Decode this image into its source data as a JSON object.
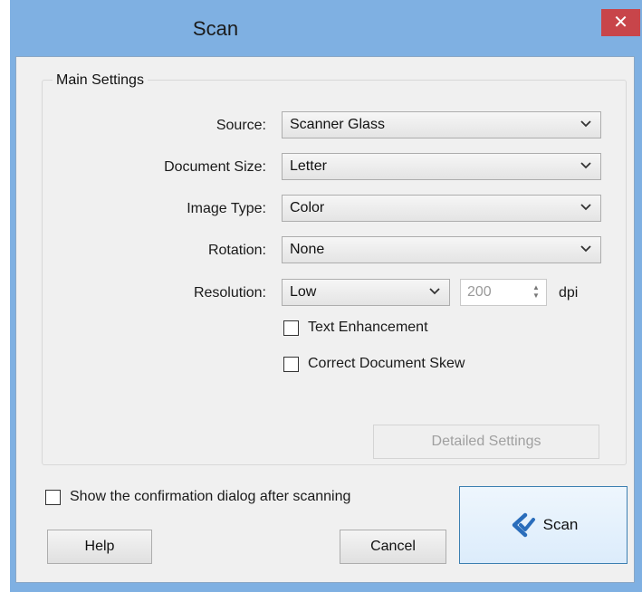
{
  "window": {
    "title": "Scan",
    "close_glyph": "✕"
  },
  "main_settings": {
    "legend": "Main Settings",
    "source": {
      "label": "Source:",
      "value": "Scanner Glass"
    },
    "document_size": {
      "label": "Document Size:",
      "value": "Letter"
    },
    "image_type": {
      "label": "Image Type:",
      "value": "Color"
    },
    "rotation": {
      "label": "Rotation:",
      "value": "None"
    },
    "resolution": {
      "label": "Resolution:",
      "value": "Low",
      "dpi_value": "200",
      "unit": "dpi"
    },
    "text_enhancement": {
      "label": "Text Enhancement",
      "checked": false
    },
    "correct_document_skew": {
      "label": "Correct Document Skew",
      "checked": false
    },
    "detailed_settings_label": "Detailed Settings"
  },
  "footer": {
    "confirmation_checkbox": {
      "label": "Show the confirmation dialog after scanning",
      "checked": false
    },
    "help_label": "Help",
    "cancel_label": "Cancel",
    "scan_label": "Scan"
  },
  "colors": {
    "title_bar": "#7fb0e2",
    "close_button": "#c8454a",
    "dialog_background": "#f0f0f0",
    "scan_button_border": "#3c7fb1",
    "scan_icon": "#2a6dbb"
  },
  "icons": {
    "combo_arrow": "chevron-down-icon",
    "scan": "epson-scan-icon",
    "spin": "spin-arrows-icon"
  }
}
